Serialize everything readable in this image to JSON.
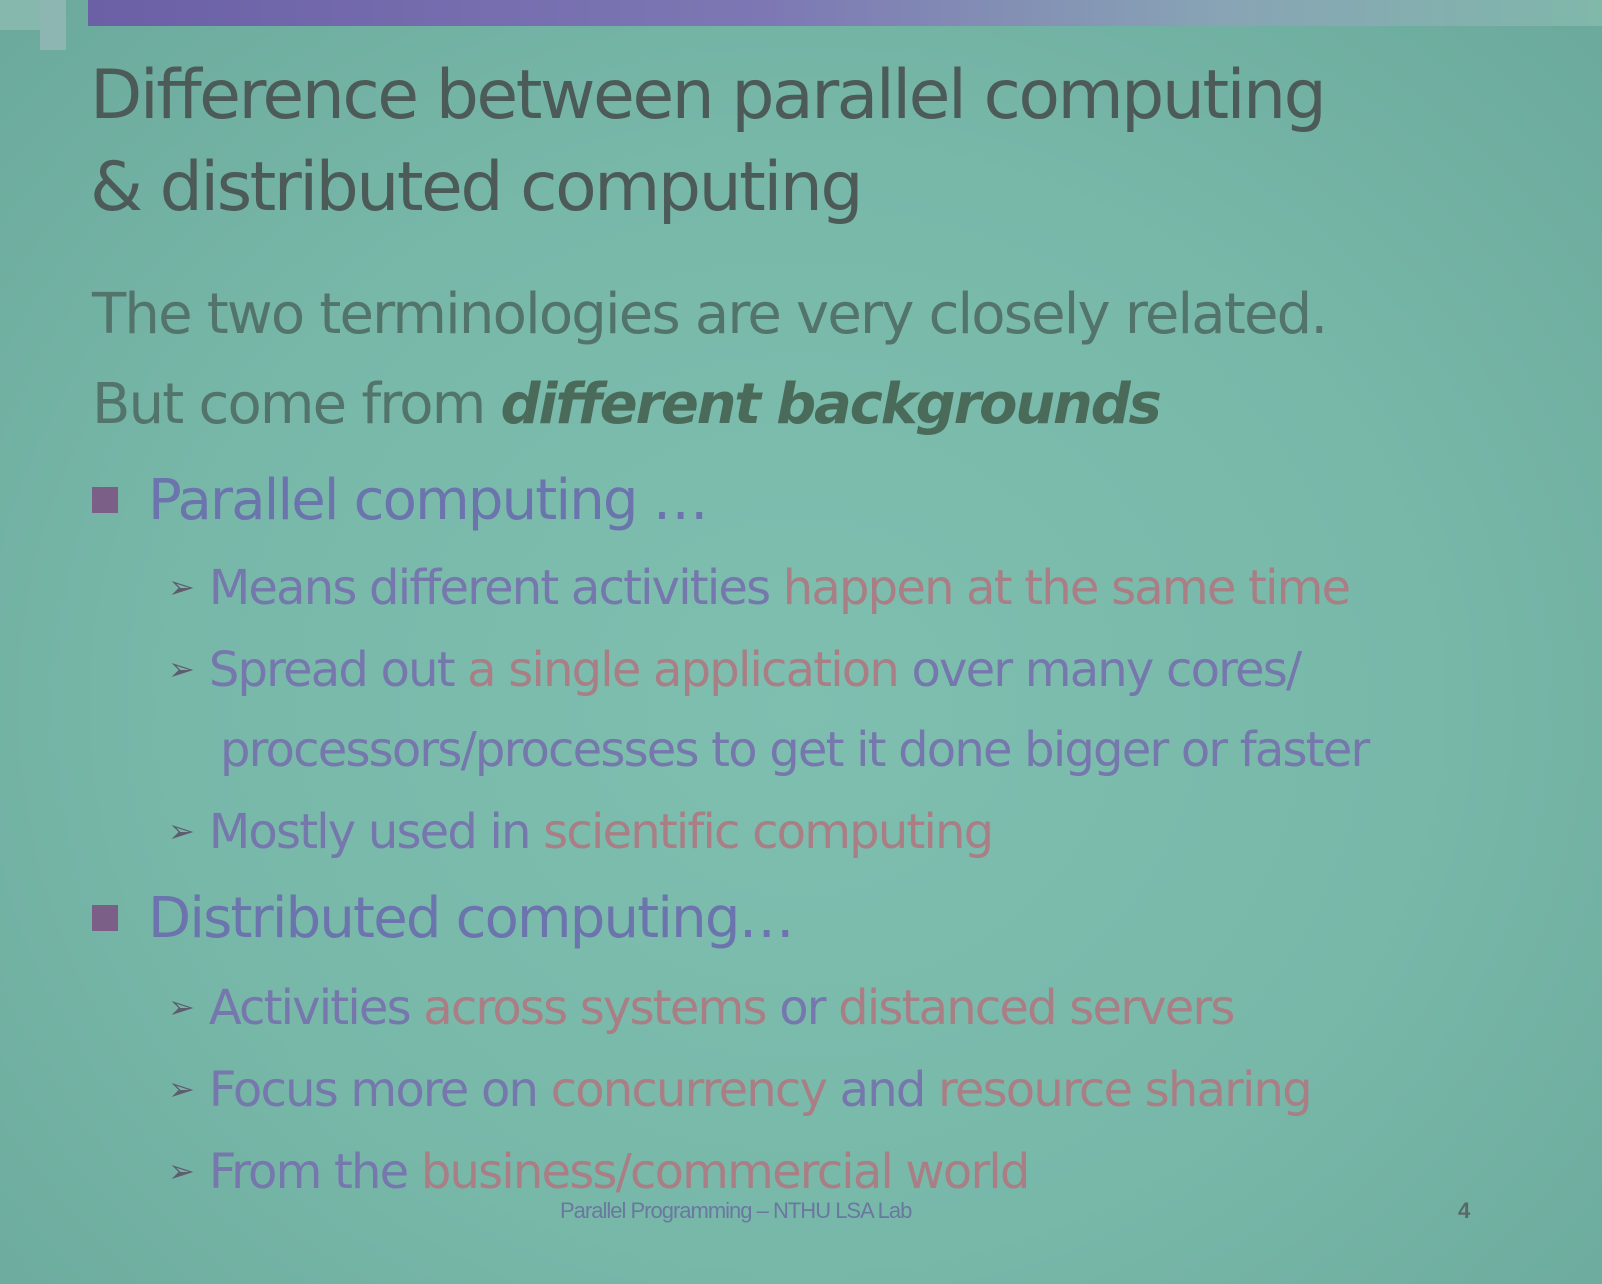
{
  "slide": {
    "title_line1": "Difference between parallel computing",
    "title_line2": "& distributed computing",
    "intro1": "The two terminologies are very closely related.",
    "intro2_prefix": "But come from ",
    "intro2_emphasis": "different backgrounds",
    "parallel": {
      "heading": "Parallel computing …",
      "items": [
        [
          {
            "text": "Means different activities ",
            "color": "blue"
          },
          {
            "text": "happen at the same time",
            "color": "red"
          }
        ],
        [
          {
            "text": "Spread out ",
            "color": "blue"
          },
          {
            "text": "a single application ",
            "color": "red"
          },
          {
            "text": "over many cores/",
            "color": "blue"
          }
        ],
        [
          {
            "text": "Mostly used in ",
            "color": "blue"
          },
          {
            "text": "scientific computing",
            "color": "red"
          }
        ]
      ],
      "item2_continuation": "processors/processes to get it done bigger or faster"
    },
    "distributed": {
      "heading": "Distributed computing…",
      "items": [
        [
          {
            "text": "Activities ",
            "color": "blue"
          },
          {
            "text": "across systems ",
            "color": "red"
          },
          {
            "text": "or ",
            "color": "blue"
          },
          {
            "text": "distanced servers",
            "color": "red"
          }
        ],
        [
          {
            "text": "Focus more on ",
            "color": "blue"
          },
          {
            "text": "concurrency ",
            "color": "red"
          },
          {
            "text": "and ",
            "color": "blue"
          },
          {
            "text": "resource sharing",
            "color": "red"
          }
        ],
        [
          {
            "text": "From the ",
            "color": "blue"
          },
          {
            "text": "business/commercial world",
            "color": "red"
          }
        ]
      ]
    },
    "footer": "Parallel Programming – NTHU LSA Lab",
    "page_number": "4",
    "arrow_glyph": "➢",
    "colors": {
      "background": "#78b8a9",
      "title": "#4c5a58",
      "blue_text": "#7577ad",
      "red_text": "#a97e85",
      "bullet": "#7b5f86",
      "accent_bar": "#6b5fa6"
    }
  }
}
